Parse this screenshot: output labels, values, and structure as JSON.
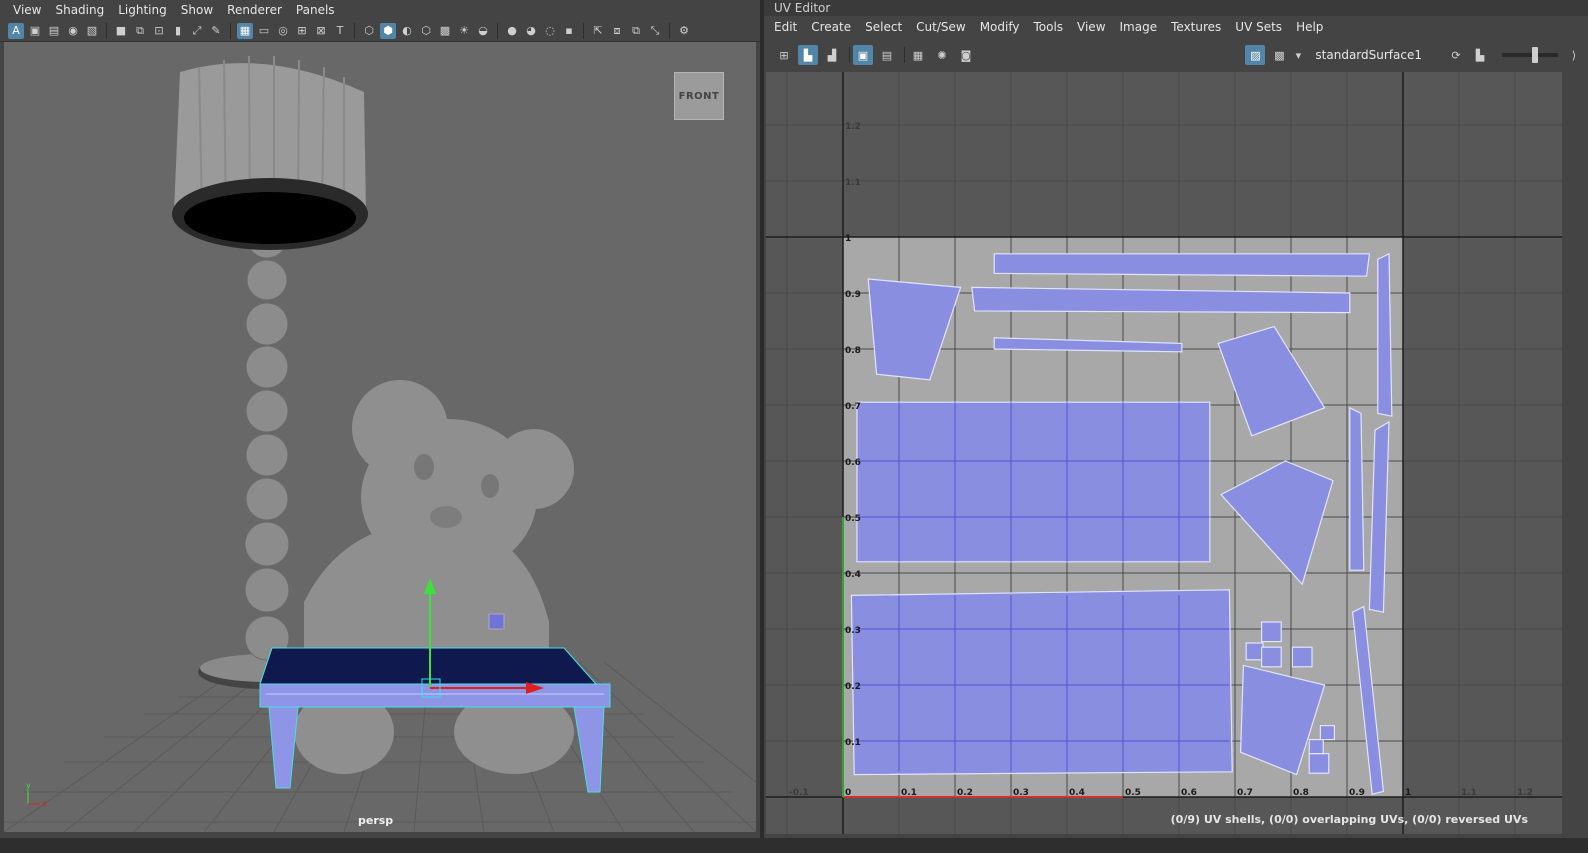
{
  "viewport": {
    "menu": [
      "View",
      "Shading",
      "Lighting",
      "Show",
      "Renderer",
      "Panels"
    ],
    "toolbar_icons": [
      "select-camera-icon",
      "camera-attributes-icon",
      "bookmark-icon",
      "image-plane-icon",
      "grid-icon",
      "film-gate-icon",
      "resolution-gate-icon",
      "safe-action-icon",
      "field-chart-icon",
      "wireframe-icon",
      "smooth-shade-icon",
      "flat-shade-icon",
      "textured-icon",
      "lights-icon",
      "shadows-icon",
      "isolate-icon",
      "xray-icon",
      "xray-joints-icon",
      "backface-icon",
      "textures-icon",
      "ambient-occlusion-icon",
      "motion-blur-icon"
    ],
    "view_cube_label": "FRONT",
    "camera_label": "persp"
  },
  "uv_editor": {
    "title": "UV Editor",
    "menu": [
      "Edit",
      "Create",
      "Select",
      "Cut/Sew",
      "Modify",
      "Tools",
      "View",
      "Image",
      "Textures",
      "UV Sets",
      "Help"
    ],
    "toolbar_icons": [
      "uv-toolkit-icon",
      "display-image-icon",
      "filter-image-icon",
      "shaded-uv-icon",
      "distortion-icon",
      "grid-toggle-icon",
      "pixel-snap-icon",
      "snapshot-icon"
    ],
    "shader_name": "standardSurface1",
    "image_dim_level": 0.6,
    "axis_tick_labels_x": [
      "-0.1",
      "0",
      "0.1",
      "0.2",
      "0.3",
      "0.4",
      "0.5",
      "0.6",
      "0.7",
      "0.8",
      "0.9",
      "1",
      "1.1",
      "1.2"
    ],
    "axis_tick_labels_y": [
      "1.2",
      "1.1",
      "1",
      "0.9",
      "0.8",
      "0.7",
      "0.6",
      "0.5",
      "0.4",
      "0.3",
      "0.2",
      "0.1"
    ],
    "status": "(0/9) UV shells, (0/0) overlapping UVs, (0/0) reversed UVs"
  },
  "colors": {
    "uv_fill": "#8a8ee0",
    "uv_edge": "#e0e4ff",
    "texture_bg": "#a8a8a8",
    "u_axis": "#d23030",
    "v_axis": "#2ea82e",
    "accent": "#5285a6"
  }
}
